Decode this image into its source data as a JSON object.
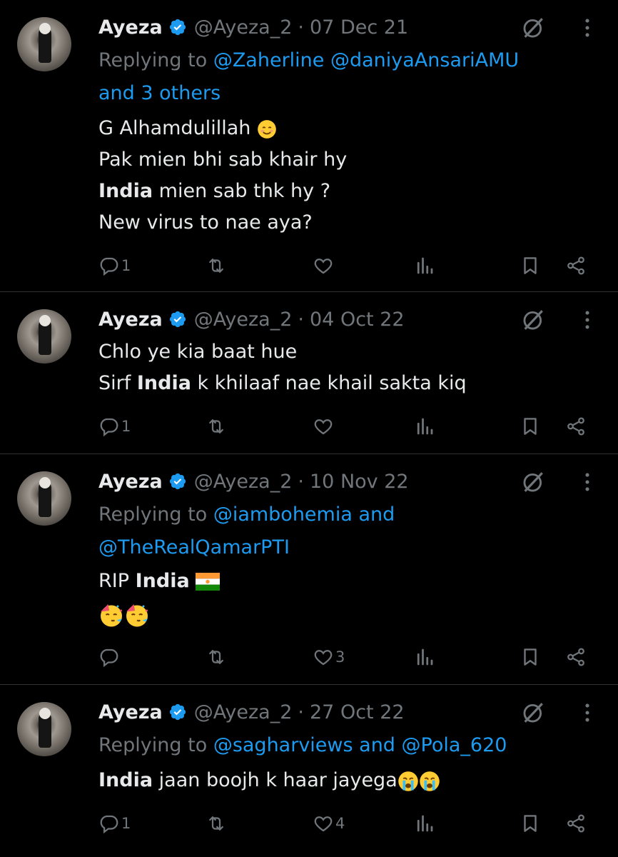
{
  "colors": {
    "background": "#000000",
    "text": "#e7e9ea",
    "muted": "#71767b",
    "link": "#1d9bf0",
    "verified": "#1d9bf0",
    "divider": "#2f3336"
  },
  "tweets": [
    {
      "name": "Ayeza",
      "handle": "@Ayeza_2",
      "sep": "·",
      "date": "07 Dec 21",
      "reply_prefix": "Replying to ",
      "reply_links": "@Zaherline @daniyaAnsariAMU",
      "reply_suffix": "and 3 others",
      "lines": [
        "G Alhamdulillah",
        "Pak mien bhi sab khair hy",
        "India",
        " mien sab thk hy ?",
        "New virus to nae aya?"
      ],
      "emoji": "smiling-face-emoji",
      "stats": {
        "replies": "1",
        "retweets": "",
        "likes": ""
      }
    },
    {
      "name": "Ayeza",
      "handle": "@Ayeza_2",
      "sep": "·",
      "date": "04 Oct 22",
      "lines": [
        "Chlo ye kia baat hue",
        "Sirf ",
        "India",
        " k khilaaf nae khail sakta kiq"
      ],
      "stats": {
        "replies": "1",
        "retweets": "",
        "likes": ""
      }
    },
    {
      "name": "Ayeza",
      "handle": "@Ayeza_2",
      "sep": "·",
      "date": "10 Nov 22",
      "reply_prefix": "Replying to ",
      "reply_links": "@iambohemia",
      "reply_and": " and",
      "reply_links2": "@TheRealQamarPTI",
      "lines": [
        "RIP ",
        "India"
      ],
      "emojis": [
        "flag-icon",
        "partying-face-emoji",
        "partying-face-emoji"
      ],
      "stats": {
        "replies": "",
        "retweets": "",
        "likes": "3"
      }
    },
    {
      "name": "Ayeza",
      "handle": "@Ayeza_2",
      "sep": "·",
      "date": "27 Oct 22",
      "reply_prefix": "Replying to ",
      "reply_links": "@sagharviews",
      "reply_and": " and ",
      "reply_links2": "@Pola_620",
      "lines": [
        "India",
        " jaan boojh k haar jayega"
      ],
      "emojis": [
        "loudly-crying-face-emoji",
        "loudly-crying-face-emoji"
      ],
      "stats": {
        "replies": "1",
        "retweets": "",
        "likes": "4"
      }
    }
  ]
}
